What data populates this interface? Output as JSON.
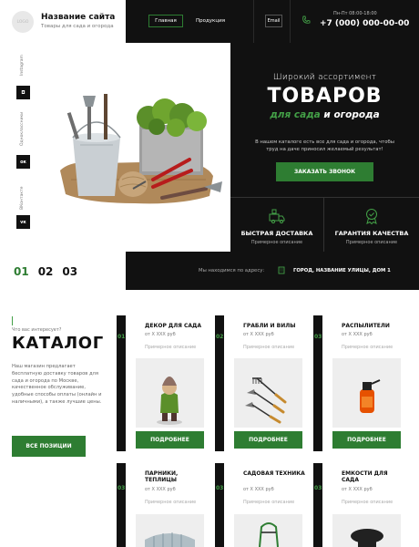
{
  "header": {
    "logo_text": "LOGO",
    "site_name": "Название сайта",
    "site_subtitle": "Товары для сада и огорода",
    "nav": [
      {
        "label": "Главная"
      },
      {
        "label": "Продукция"
      }
    ],
    "email_label": "Email",
    "hours": "Пн-Пт 08:00-18:00",
    "phone": "+7 (000) 000-00-00"
  },
  "social": [
    {
      "label": "Instagram",
      "icon": "instagram-icon",
      "glyph": "◘"
    },
    {
      "label": "Одноклассники",
      "icon": "ok-icon",
      "glyph": "ок"
    },
    {
      "label": "ВКонтакте",
      "icon": "vk-icon",
      "glyph": "ᴠк"
    }
  ],
  "hero": {
    "subtitle": "Широкий ассортимент",
    "title": "ТОВАРОВ",
    "title_green": "для сада",
    "title_rest": " и огорода",
    "description": "В нашем каталоге есть все для сада и огорода, чтобы труд на даче приносил желаемый результат!",
    "cta_label": "ЗАКАЗАТЬ ЗВОНОК"
  },
  "features": [
    {
      "title": "БЫСТРАЯ ДОСТАВКА",
      "desc": "Примерное описание",
      "icon": "delivery-truck-icon"
    },
    {
      "title": "ГАРАНТИЯ КАЧЕСТВА",
      "desc": "Примерное описание",
      "icon": "quality-badge-icon"
    }
  ],
  "slider_steps": [
    "01",
    "02",
    "03"
  ],
  "address_bar": {
    "label": "Мы находимся по адресу:",
    "address": "ГОРОД, НАЗВАНИЕ УЛИЦЫ, ДОМ 1"
  },
  "catalog": {
    "question": "Что вас интересует?",
    "title": "КАТАЛОГ",
    "text": "Наш магазин предлагает бесплатную доставку товаров для сада и огорода по Москве, качественное обслуживание, удобные способы оплаты (онлайн и наличными), а также лучшие цены.",
    "all_button": "ВСЕ ПОЗИЦИИ"
  },
  "products": [
    {
      "num": "01",
      "title": "ДЕКОР ДЛЯ САДА",
      "price": "от X XXX руб",
      "desc": "Примерное описание",
      "button": "ПОДРОБНЕЕ"
    },
    {
      "num": "02",
      "title": "ГРАБЛИ И ВИЛЫ",
      "price": "от X XXX руб",
      "desc": "Примерное описание",
      "button": "ПОДРОБНЕЕ"
    },
    {
      "num": "03",
      "title": "РАСПЫЛИТЕЛИ",
      "price": "от X XXX руб",
      "desc": "Примерное описание",
      "button": "ПОДРОБНЕЕ"
    },
    {
      "num": "03",
      "title": "ПАРНИКИ, ТЕПЛИЦЫ",
      "price": "от X XXX руб",
      "desc": "Примерное описание"
    },
    {
      "num": "03",
      "title": "САДОВАЯ ТЕХНИКА",
      "price": "от X XXX руб",
      "desc": "Примерное описание"
    },
    {
      "num": "03",
      "title": "ЕМКОСТИ ДЛЯ САДА",
      "price": "от X XXX руб",
      "desc": "Примерное описание"
    }
  ],
  "colors": {
    "accent": "#2e7d32",
    "dark": "#111111",
    "accent_light": "#43a047"
  }
}
